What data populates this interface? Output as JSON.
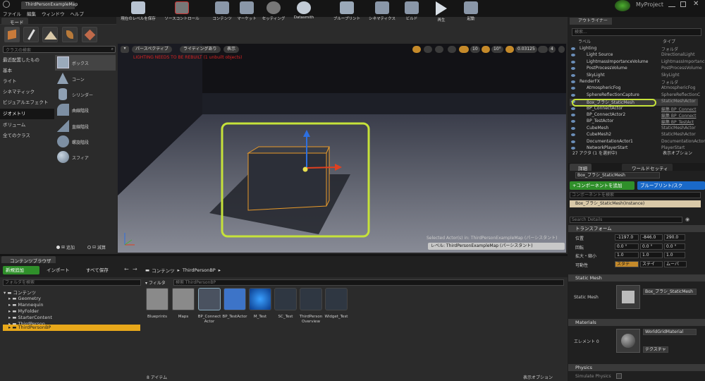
{
  "titlebar": {
    "tab_label": "ThirdPersonExampleMap",
    "project": "MyProject"
  },
  "menu": [
    "ファイル",
    "編集",
    "ウィンドウ",
    "ヘルプ"
  ],
  "modes": {
    "header": "モード",
    "search_placeholder": "クラスの検索",
    "categories": [
      "最近配置したもの",
      "基本",
      "ライト",
      "シネマティック",
      "ビジュアルエフェクト",
      "ジオメトリ",
      "ボリューム",
      "全てのクラス"
    ],
    "selected_category": "ジオメトリ",
    "items": [
      "ボックス",
      "コーン",
      "シリンダー",
      "曲線階段",
      "直線階段",
      "螺旋階段",
      "スフィア"
    ],
    "add_label": "追加",
    "subtract_label": "減算"
  },
  "toolbar": {
    "buttons": [
      "現在のレベルを保存",
      "ソースコントロール",
      "コンテンツ",
      "マーケット",
      "セッティング",
      "Datasmith",
      "ブループリント",
      "シネマティクス",
      "ビルド",
      "再生",
      "起動"
    ]
  },
  "viewport": {
    "perspective": "パースペクティブ",
    "lighting": "ライティングあり",
    "show": "表示",
    "snap_angle": "10°",
    "snap_grid": "10",
    "snap_scale": "0.03125",
    "camera_speed": "4",
    "warning": "LIGHTING NEEDS TO BE REBUILT (1 unbuilt objects)",
    "selected_info": "Selected Actor(s) in:  ThirdPersonExampleMap (パーシスタント)",
    "level_label": "レベル:  ThirdPersonExampleMap (パーシスタント)"
  },
  "outliner": {
    "tab": "アウトライナー",
    "search_placeholder": "検索...",
    "col_label": "ラベル",
    "col_type": "タイプ",
    "rows": [
      {
        "name": "Lighting",
        "type": "フォルダ",
        "link": false
      },
      {
        "name": "Light Source",
        "type": "DirectionalLight",
        "link": false
      },
      {
        "name": "LightmassImportanceVolume",
        "type": "LightmassImportance",
        "link": false
      },
      {
        "name": "PostProcessVolume",
        "type": "PostProcessVolume",
        "link": false
      },
      {
        "name": "SkyLight",
        "type": "SkyLight",
        "link": false
      },
      {
        "name": "RenderFX",
        "type": "フォルダ",
        "link": false
      },
      {
        "name": "AtmosphericFog",
        "type": "AtmosphericFog",
        "link": false
      },
      {
        "name": "SphereReflectionCapture",
        "type": "SphereReflectionC",
        "link": false
      },
      {
        "name": "Box_ブラシ_StaticMesh",
        "type": "StaticMeshActor",
        "link": false
      },
      {
        "name": "BP_ConnectActor",
        "type": "編集 BP_Connect",
        "link": true
      },
      {
        "name": "BP_ConnectActor2",
        "type": "編集 BP_Connect",
        "link": true
      },
      {
        "name": "BP_TestActor",
        "type": "編集 BP_TestAct",
        "link": true
      },
      {
        "name": "CubeMesh",
        "type": "StaticMeshActor",
        "link": false
      },
      {
        "name": "CubeMesh2",
        "type": "StaticMeshActor",
        "link": false
      },
      {
        "name": "DocumentationActor1",
        "type": "DocumentationActor",
        "link": false
      },
      {
        "name": "NetworkPlayerStart",
        "type": "PlayerStart",
        "link": false
      }
    ],
    "count": "27 アクタ (1 を選択中)",
    "view_options": "表示オプション"
  },
  "details": {
    "tab": "詳細",
    "world_tab": "ワールドセッティ",
    "actor_name": "Box_ブラシ_StaticMesh",
    "add_component": "+コンポーネントを追加",
    "blueprint_script": "ブループリント/スク",
    "comp_search": "コンポーネントを検索",
    "instance": "Box_ブラシ_StaticMesh(Instance)",
    "search_details": "Search Details",
    "transform_header": "トランスフォーム",
    "location_label": "位置",
    "location": [
      "-1197.0",
      "-846.0",
      "290.0"
    ],
    "rotation_label": "回転",
    "rotation": [
      "0.0 °",
      "0.0 °",
      "0.0 °"
    ],
    "scale_label": "拡大・縮小",
    "scale": [
      "1.0",
      "1.0",
      "1.0"
    ],
    "mobility_label": "可動性",
    "mobility": [
      "スタテ",
      "ステイ",
      "ムーバ"
    ],
    "static_mesh_header": "Static Mesh",
    "static_mesh_label": "Static Mesh",
    "static_mesh_value": "Box_ブラシ_StaticMesh",
    "materials_header": "Materials",
    "element_label": "エレメント 0",
    "material_value": "WorldGridMaterial",
    "texture_label": "テクスチャ",
    "physics_header": "Physics",
    "simulate_physics": "Simulate Physics"
  },
  "content_browser": {
    "tab": "コンテンツブラウザ",
    "add_new": "新規追加",
    "import": "インポート",
    "save_all": "すべて保存",
    "path": [
      "コンテンツ",
      "ThirdPersonBP"
    ],
    "folder_search": "フォルダを検索",
    "filter": "フィルタ",
    "asset_search": "検索 ThirdPersonBP",
    "tree_root": "コンテンツ",
    "tree": [
      "Geometry",
      "Mannequin",
      "MyFolder",
      "StarterContent",
      "ThirdPerson",
      "ThirdPersonBP"
    ],
    "assets": [
      "Blueprints",
      "Maps",
      "BP_Connect Actor",
      "BP_TestActor",
      "M_Test",
      "SC_Test",
      "ThirdPerson Overview",
      "Widget_Test"
    ],
    "item_count": "8 アイテム",
    "view_options": "表示オプション"
  }
}
